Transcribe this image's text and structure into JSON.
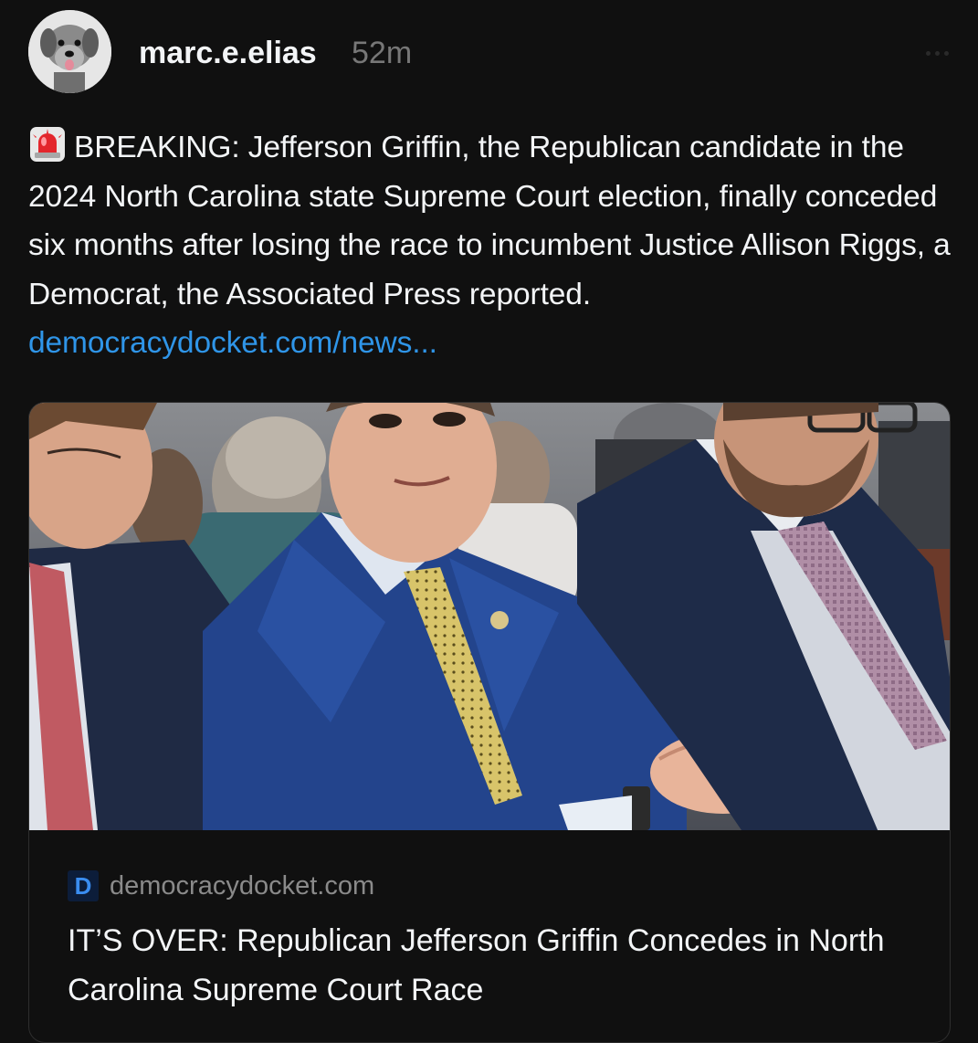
{
  "post": {
    "username": "marc.e.elias",
    "timestamp": "52m",
    "text": "BREAKING: Jefferson Griffin, the Republican candidate in the 2024 North Carolina state Supreme Court election, finally conceded six months after losing the race to incumbent Justice Allison Riggs, a Democrat, the Associated Press reported.",
    "link_text": "democracydocket.com/news...",
    "leading_icon": "police-siren-emoji"
  },
  "card": {
    "favicon_letter": "D",
    "domain": "democracydocket.com",
    "title": "IT’S OVER: Republican Jefferson Griffin Concedes in North Carolina Supreme Court Race"
  },
  "colors": {
    "background": "#101010",
    "link": "#2f95e8",
    "muted": "#777777"
  }
}
